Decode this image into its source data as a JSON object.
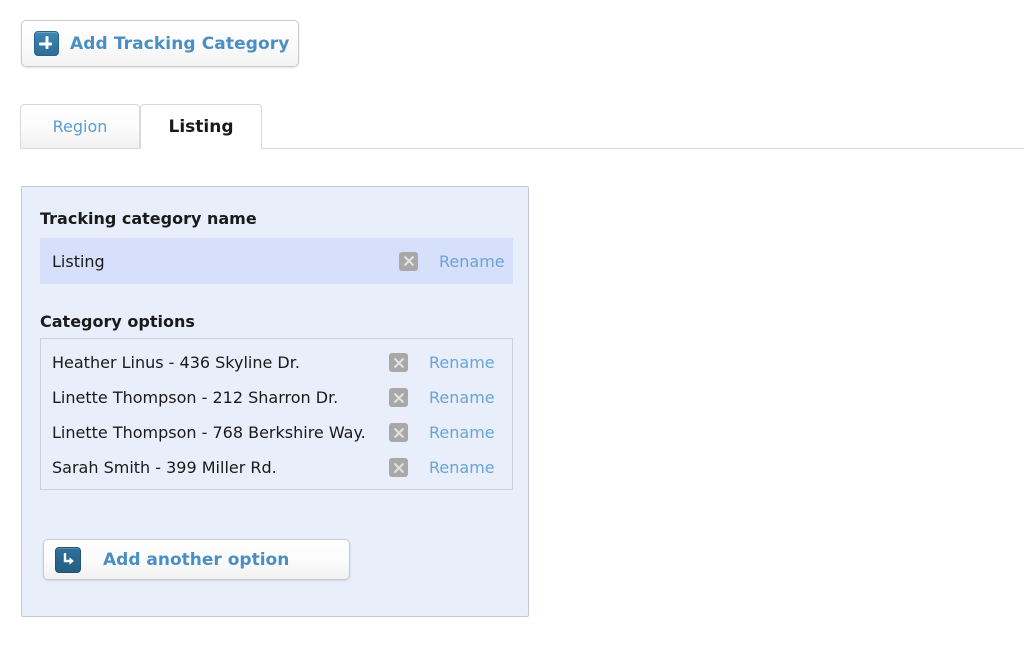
{
  "toolbar": {
    "add_category_label": "Add Tracking Category",
    "add_category_icon": "plus-icon"
  },
  "tabs": [
    {
      "label": "Region",
      "active": false
    },
    {
      "label": "Listing",
      "active": true
    }
  ],
  "panel": {
    "name_heading": "Tracking category name",
    "options_heading": "Category options",
    "category_name": "Listing",
    "rename_label": "Rename",
    "delete_icon": "close-x-icon",
    "options": [
      "Heather Linus - 436 Skyline Dr.",
      "Linette Thompson - 212 Sharron Dr.",
      "Linette Thompson - 768 Berkshire Way.",
      "Sarah Smith - 399 Miller Rd."
    ],
    "add_option_label": "Add another option",
    "add_option_icon": "arrow-turn-down-right-icon"
  },
  "colors": {
    "link_blue": "#6ba3d6",
    "button_label_blue": "#4a8fc4",
    "panel_bg": "#e8eefa",
    "name_row_bg": "#d6e0fa",
    "icon_blue_dark": "#2f6f99",
    "delete_gray": "#a8a8a8",
    "border_gray": "#c3c7cf"
  }
}
